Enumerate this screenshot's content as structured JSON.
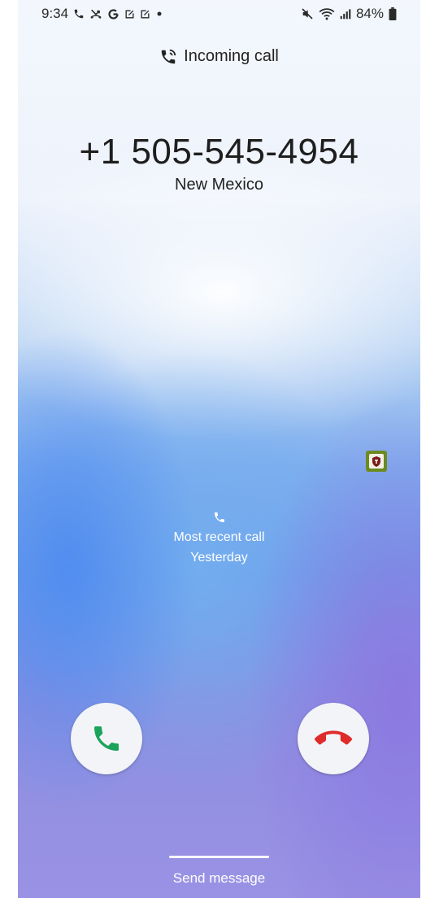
{
  "status_bar": {
    "time": "9:34",
    "battery": "84%",
    "left_icons": [
      "phone-icon",
      "missed-call-icon",
      "google-icon",
      "edit-icon",
      "edit-icon",
      "dot-icon"
    ],
    "right_icons": [
      "mute-icon",
      "wifi-icon",
      "signal-icon",
      "battery-icon"
    ]
  },
  "call": {
    "header": "Incoming call",
    "number": "+1 505-545-4954",
    "location": "New Mexico"
  },
  "recent": {
    "label": "Most recent call",
    "when": "Yesterday"
  },
  "actions": {
    "answer_icon": "answer-phone-icon",
    "decline_icon": "decline-phone-icon",
    "send_message": "Send message"
  },
  "colors": {
    "answer": "#1aa35a",
    "decline": "#e02b2b"
  }
}
